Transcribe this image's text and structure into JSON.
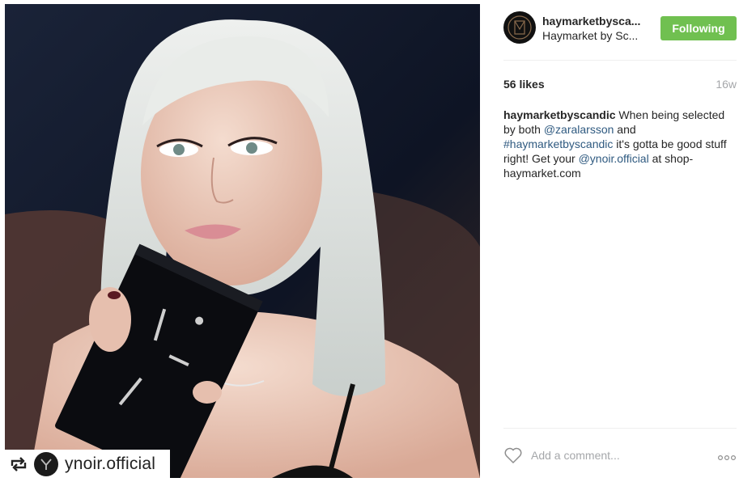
{
  "post": {
    "photo": {
      "alt": "",
      "repost_handle": "ynoir.official"
    },
    "author": {
      "username": "haymarketbysca...",
      "full_name": "Haymarket by Sc...",
      "avatar_icon": "haymarket-logo-icon"
    },
    "follow_button": {
      "label": "Following",
      "color": "#70c050"
    },
    "likes": "56 likes",
    "timestamp": "16w",
    "caption": {
      "username": "haymarketbyscandic",
      "parts": [
        {
          "text": " When being selected by both ",
          "type": "text"
        },
        {
          "text": "@zaralarsson",
          "type": "mention"
        },
        {
          "text": " and ",
          "type": "text"
        },
        {
          "text": "#haymarketbyscandic",
          "type": "hashtag"
        },
        {
          "text": " it's gotta be good stuff right! Get your ",
          "type": "text"
        },
        {
          "text": "@ynoir.official",
          "type": "mention"
        },
        {
          "text": " at shop-haymarket.com",
          "type": "text"
        }
      ]
    },
    "comment_box": {
      "placeholder": "Add a comment..."
    },
    "icons": {
      "like": "heart-icon",
      "more": "more-options-icon",
      "repost": "repost-icon"
    },
    "link_color": "#2f5a80"
  }
}
